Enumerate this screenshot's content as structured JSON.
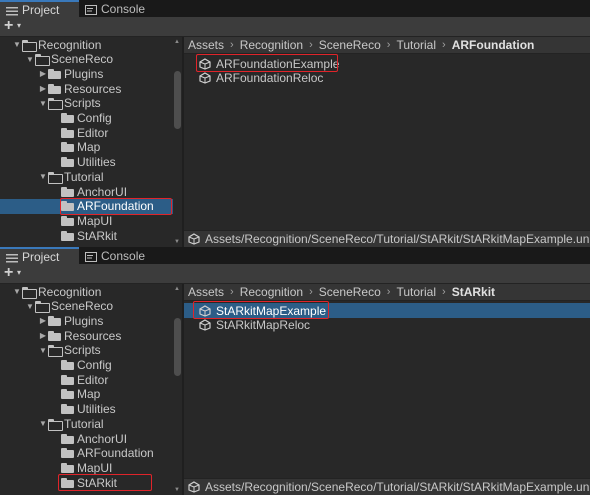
{
  "top_panel": {
    "tabs": [
      {
        "label": "Project",
        "active": true
      },
      {
        "label": "Console",
        "active": false
      }
    ],
    "toolbar": {
      "add_label": "+",
      "add_caret": "▾"
    },
    "tree": [
      {
        "label": "Recognition",
        "depth": 0,
        "expanded": true
      },
      {
        "label": "SceneReco",
        "depth": 1,
        "expanded": true
      },
      {
        "label": "Plugins",
        "depth": 2,
        "expanded": false
      },
      {
        "label": "Resources",
        "depth": 2,
        "expanded": false
      },
      {
        "label": "Scripts",
        "depth": 2,
        "expanded": true
      },
      {
        "label": "Config",
        "depth": 3,
        "expanded": null
      },
      {
        "label": "Editor",
        "depth": 3,
        "expanded": null
      },
      {
        "label": "Map",
        "depth": 3,
        "expanded": null
      },
      {
        "label": "Utilities",
        "depth": 3,
        "expanded": null
      },
      {
        "label": "Tutorial",
        "depth": 2,
        "expanded": true
      },
      {
        "label": "AnchorUI",
        "depth": 3,
        "expanded": null
      },
      {
        "label": "ARFoundation",
        "depth": 3,
        "expanded": null,
        "selected": true
      },
      {
        "label": "MapUI",
        "depth": 3,
        "expanded": null
      },
      {
        "label": "StARkit",
        "depth": 3,
        "expanded": null
      }
    ],
    "breadcrumb": [
      "Assets",
      "Recognition",
      "SceneReco",
      "Tutorial",
      "ARFoundation"
    ],
    "files": [
      {
        "label": "ARFoundationExample",
        "selected": false
      },
      {
        "label": "ARFoundationReloc",
        "selected": false
      }
    ],
    "status_path": "Assets/Recognition/SceneReco/Tutorial/StARkit/StARkitMapExample.unity"
  },
  "bottom_panel": {
    "tabs": [
      {
        "label": "Project",
        "active": true
      },
      {
        "label": "Console",
        "active": false
      }
    ],
    "toolbar": {
      "add_label": "+",
      "add_caret": "▾"
    },
    "tree": [
      {
        "label": "Recognition",
        "depth": 0,
        "expanded": true
      },
      {
        "label": "SceneReco",
        "depth": 1,
        "expanded": true
      },
      {
        "label": "Plugins",
        "depth": 2,
        "expanded": false
      },
      {
        "label": "Resources",
        "depth": 2,
        "expanded": false
      },
      {
        "label": "Scripts",
        "depth": 2,
        "expanded": true
      },
      {
        "label": "Config",
        "depth": 3,
        "expanded": null
      },
      {
        "label": "Editor",
        "depth": 3,
        "expanded": null
      },
      {
        "label": "Map",
        "depth": 3,
        "expanded": null
      },
      {
        "label": "Utilities",
        "depth": 3,
        "expanded": null
      },
      {
        "label": "Tutorial",
        "depth": 2,
        "expanded": true
      },
      {
        "label": "AnchorUI",
        "depth": 3,
        "expanded": null
      },
      {
        "label": "ARFoundation",
        "depth": 3,
        "expanded": null
      },
      {
        "label": "MapUI",
        "depth": 3,
        "expanded": null
      },
      {
        "label": "StARkit",
        "depth": 3,
        "expanded": null
      }
    ],
    "breadcrumb": [
      "Assets",
      "Recognition",
      "SceneReco",
      "Tutorial",
      "StARkit"
    ],
    "files": [
      {
        "label": "StARkitMapExample",
        "selected": true
      },
      {
        "label": "StARkitMapReloc",
        "selected": false
      }
    ],
    "status_path": "Assets/Recognition/SceneReco/Tutorial/StARkit/StARkitMapExample.unity"
  },
  "colors": {
    "selection": "#2c5d87",
    "highlight_border": "#e0242a",
    "panel_bg": "#282828"
  },
  "icons": {
    "tab": "list-icon",
    "console_tab": "console-icon",
    "folder": "folder-icon",
    "scene": "unity-scene-icon"
  }
}
